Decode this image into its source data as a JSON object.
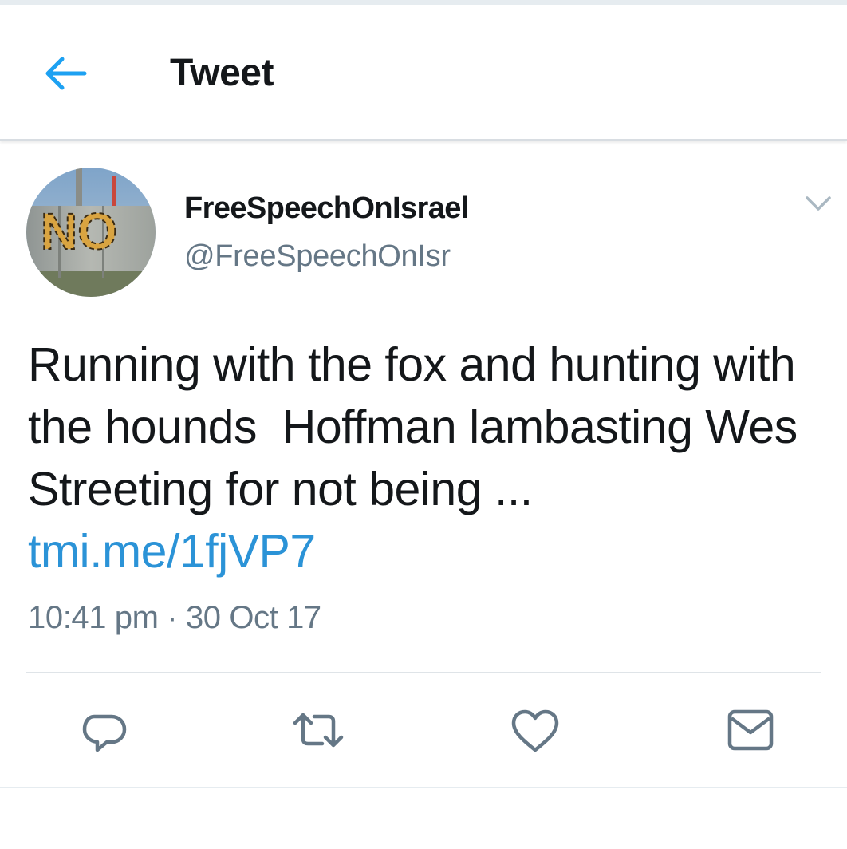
{
  "header": {
    "back_icon": "arrow-left-icon",
    "title": "Tweet"
  },
  "tweet": {
    "author": {
      "display_name": "FreeSpeechOnIsrael",
      "handle": "@FreeSpeechOnIsr",
      "avatar_text": "NO"
    },
    "menu_icon": "chevron-down-icon",
    "text": "Running with the fox and hunting with the hounds  Hoffman lambasting Wes Streeting for not being ... ",
    "link": "tmi.me/1fjVP7",
    "time": "10:41 pm",
    "separator": " · ",
    "date": "30 Oct 17"
  },
  "actions": [
    {
      "name": "reply",
      "icon": "reply-icon"
    },
    {
      "name": "retweet",
      "icon": "retweet-icon"
    },
    {
      "name": "like",
      "icon": "heart-icon"
    },
    {
      "name": "share",
      "icon": "envelope-icon"
    }
  ],
  "colors": {
    "accent": "#1da1f2",
    "link": "#2b93d7",
    "text": "#14171a",
    "secondary": "#657786",
    "icon": "#657786"
  }
}
